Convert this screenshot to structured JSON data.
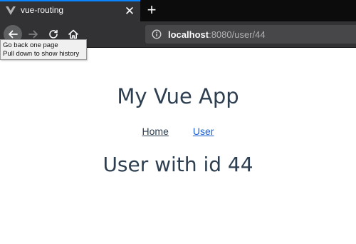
{
  "browser": {
    "tab": {
      "title": "vue-routing",
      "favicon": "vue-logo-icon",
      "close_icon": "close-icon"
    },
    "new_tab_icon": "plus-icon",
    "nav": {
      "back_icon": "arrow-left-icon",
      "forward_icon": "arrow-right-icon",
      "reload_icon": "reload-icon",
      "home_icon": "home-icon"
    },
    "url": {
      "info_icon": "info-icon",
      "host": "localhost",
      "rest": ":8080/user/44"
    },
    "tooltip": {
      "line1": "Go back one page",
      "line2": "Pull down to show history"
    },
    "colors": {
      "tab_accent": "#0a84ff",
      "toolbar": "#323234",
      "tabstrip": "#0c0c0d"
    }
  },
  "page": {
    "title": "My Vue App",
    "links": [
      {
        "label": "Home",
        "active": false
      },
      {
        "label": "User",
        "active": true
      }
    ],
    "heading": "User with id 44",
    "colors": {
      "text": "#2c3e50",
      "active_link": "#1a5fd1"
    }
  }
}
